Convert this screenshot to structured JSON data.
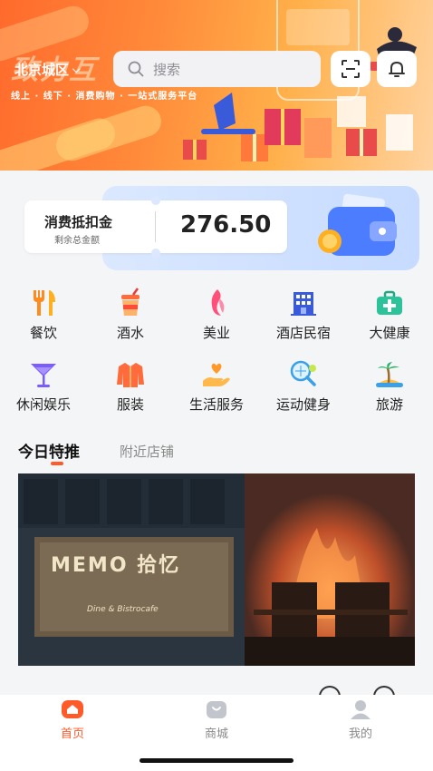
{
  "header": {
    "city": "北京城区",
    "search_placeholder": "搜索",
    "banner_title": "致力互",
    "banner_slogan": "线上 · 线下 · 消费购物 · 一站式服务平台"
  },
  "balance": {
    "title": "消费抵扣金",
    "subtitle": "剩余总金额",
    "amount": "276.50"
  },
  "categories": [
    {
      "label": "餐饮",
      "icon": "utensils-icon"
    },
    {
      "label": "酒水",
      "icon": "drink-cup-icon"
    },
    {
      "label": "美业",
      "icon": "beauty-icon"
    },
    {
      "label": "酒店民宿",
      "icon": "hotel-icon"
    },
    {
      "label": "大健康",
      "icon": "medical-kit-icon"
    },
    {
      "label": "休闲娱乐",
      "icon": "cocktail-icon"
    },
    {
      "label": "服装",
      "icon": "jacket-icon"
    },
    {
      "label": "生活服务",
      "icon": "hand-heart-icon"
    },
    {
      "label": "运动健身",
      "icon": "tennis-icon"
    },
    {
      "label": "旅游",
      "icon": "palm-island-icon"
    }
  ],
  "tabs": {
    "active": "今日特推",
    "inactive": "附近店铺"
  },
  "featured": {
    "sign_text": "MEMO 拾忆",
    "sign_sub": "Dine & Bistrocafe"
  },
  "bottom_nav": [
    {
      "label": "首页",
      "icon": "home-icon",
      "active": true
    },
    {
      "label": "商城",
      "icon": "shop-bag-icon",
      "active": false
    },
    {
      "label": "我的",
      "icon": "user-icon",
      "active": false
    }
  ],
  "colors": {
    "accent": "#ff5a2a",
    "inactive_nav": "#8a8a8a",
    "card_blue": "#c6dbff"
  }
}
